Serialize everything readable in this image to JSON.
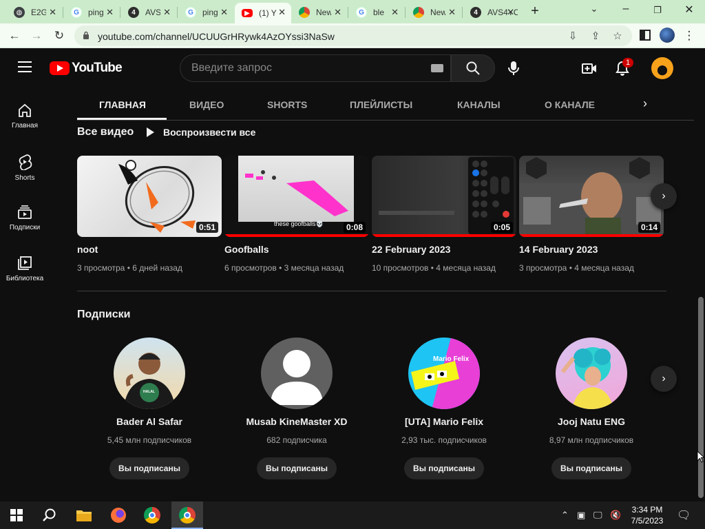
{
  "browser": {
    "tabs": [
      {
        "title": "E2G",
        "favicon": "globe-icon"
      },
      {
        "title": "ping",
        "favicon": "google-icon"
      },
      {
        "title": "AVS",
        "favicon": "number-four-icon"
      },
      {
        "title": "ping",
        "favicon": "google-icon"
      },
      {
        "title": "(1) Y",
        "favicon": "youtube-icon",
        "active": true
      },
      {
        "title": "New",
        "favicon": "chrome-icon"
      },
      {
        "title": "ble",
        "favicon": "google-icon"
      },
      {
        "title": "New",
        "favicon": "chrome-icon"
      },
      {
        "title": "AVS4YO",
        "favicon": "number-four-icon"
      }
    ],
    "url": "youtube.com/channel/UCUUGrHRywk4AzOYssi3NaSw"
  },
  "youtube": {
    "logo_text": "YouTube",
    "search_placeholder": "Введите запрос",
    "notifications_count": "1",
    "guide": [
      {
        "label": "Главная",
        "icon": "home-icon"
      },
      {
        "label": "Shorts",
        "icon": "shorts-icon"
      },
      {
        "label": "Подписки",
        "icon": "subscriptions-icon"
      },
      {
        "label": "Библиотека",
        "icon": "library-icon"
      }
    ],
    "channel_tabs": [
      "ГЛАВНАЯ",
      "ВИДЕО",
      "SHORTS",
      "ПЛЕЙЛИСТЫ",
      "КАНАЛЫ",
      "О КАНАЛЕ"
    ],
    "all_videos": {
      "title": "Все видео",
      "play_all": "Воспроизвести все",
      "videos": [
        {
          "title": "noot",
          "duration": "0:51",
          "views": "3 просмотра",
          "age": "6 дней назад",
          "watched": 0
        },
        {
          "title": "Goofballs",
          "duration": "0:08",
          "views": "6 просмотров",
          "age": "3 месяца назад",
          "caption": "these goofballs💀",
          "watched": 1
        },
        {
          "title": "22 February 2023",
          "duration": "0:05",
          "views": "10 просмотров",
          "age": "4 месяца назад",
          "watched": 1
        },
        {
          "title": "14 February 2023",
          "duration": "0:14",
          "views": "3 просмотра",
          "age": "4 месяца назад",
          "watched": 1
        }
      ]
    },
    "subscriptions": {
      "title": "Подписки",
      "channels": [
        {
          "name": "Bader Al Safar",
          "subscribers": "5,45 млн подписчиков",
          "button": "Вы подписаны",
          "avatar_text": "HALAL"
        },
        {
          "name": "Musab KineMaster XD",
          "subscribers": "682 подписчика",
          "button": "Вы подписаны"
        },
        {
          "name": "[UTA] Mario Felix",
          "subscribers": "2,93 тыс. подписчиков",
          "button": "Вы подписаны",
          "avatar_text": "Mario Felix"
        },
        {
          "name": "Jooj Natu ENG",
          "subscribers": "8,97 млн подписчиков",
          "button": "Вы подписаны"
        }
      ]
    }
  },
  "taskbar": {
    "time": "3:34 PM",
    "date": "7/5/2023"
  }
}
